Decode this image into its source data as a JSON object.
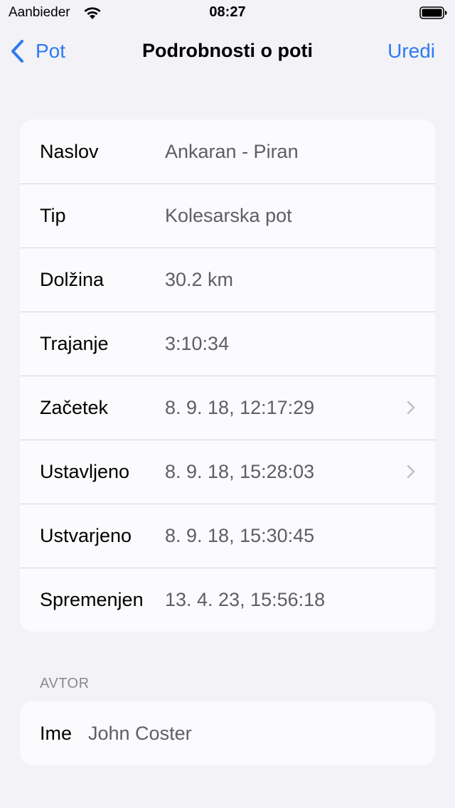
{
  "status_bar": {
    "carrier": "Aanbieder",
    "time": "08:27"
  },
  "nav": {
    "back_label": "Pot",
    "title": "Podrobnosti o poti",
    "edit_label": "Uredi"
  },
  "details": {
    "rows": [
      {
        "label": "Naslov",
        "value": "Ankaran - Piran",
        "chevron": false
      },
      {
        "label": "Tip",
        "value": "Kolesarska pot",
        "chevron": false
      },
      {
        "label": "Dolžina",
        "value": "30.2 km",
        "chevron": false
      },
      {
        "label": "Trajanje",
        "value": "3:10:34",
        "chevron": false
      },
      {
        "label": "Začetek",
        "value": "8. 9. 18, 12:17:29",
        "chevron": true
      },
      {
        "label": "Ustavljeno",
        "value": "8. 9. 18, 15:28:03",
        "chevron": true
      },
      {
        "label": "Ustvarjeno",
        "value": "8. 9. 18, 15:30:45",
        "chevron": false
      },
      {
        "label": "Spremenjen",
        "value": "13. 4. 23, 15:56:18",
        "chevron": false
      }
    ]
  },
  "author": {
    "header": "AVTOR",
    "name_label": "Ime",
    "name_value": "John Coster"
  },
  "colors": {
    "accent": "#2F7BF0",
    "background": "#F2F2F7",
    "group_background": "#FBFBFD",
    "secondary_text": "#5E5E63"
  }
}
